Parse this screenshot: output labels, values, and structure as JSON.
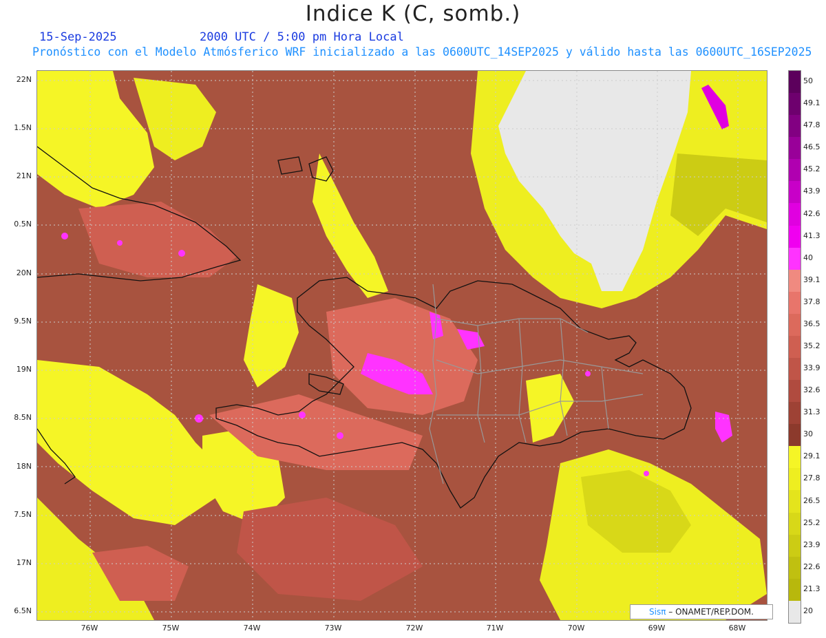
{
  "header": {
    "title": "Indice K (C, somb.)",
    "date": "15-Sep-2025",
    "time": "2000 UTC / 5:00 pm Hora Local",
    "subtitle": "Pronóstico con el Modelo Atmósferico WRF inicializado a las 0600UTC_14SEP2025 y válido hasta las  0600UTC_16SEP2025"
  },
  "axes": {
    "y_ticks": [
      "22N",
      "1.5N",
      "21N",
      "0.5N",
      "20N",
      "9.5N",
      "19N",
      "8.5N",
      "18N",
      "7.5N",
      "17N",
      "6.5N"
    ],
    "x_ticks": [
      "76W",
      "75W",
      "74W",
      "73W",
      "72W",
      "71W",
      "70W",
      "69W",
      "68W"
    ]
  },
  "colorbar": {
    "labels": [
      "50",
      "49.1",
      "47.8",
      "46.5",
      "45.2",
      "43.9",
      "42.6",
      "41.3",
      "40",
      "39.1",
      "37.8",
      "36.5",
      "35.2",
      "33.9",
      "32.6",
      "31.3",
      "30",
      "29.1",
      "27.8",
      "26.5",
      "25.2",
      "23.9",
      "22.6",
      "21.3",
      "20"
    ],
    "colors": [
      "#5c005c",
      "#6e006e",
      "#820082",
      "#990099",
      "#b000b0",
      "#c800c8",
      "#e000e0",
      "#f000f0",
      "#ff33ff",
      "#f08a80",
      "#e8756b",
      "#dc6a5c",
      "#cf5f51",
      "#c05548",
      "#b04b3f",
      "#9e4235",
      "#8c3a2c",
      "#f5f526",
      "#eeee20",
      "#e4e41c",
      "#d8d818",
      "#cccc14",
      "#c0c010",
      "#b8b80c",
      "#e8e8e8"
    ]
  },
  "credit": {
    "sis": "Sisπ",
    "text": "– ONAMET/REP.DOM."
  }
}
